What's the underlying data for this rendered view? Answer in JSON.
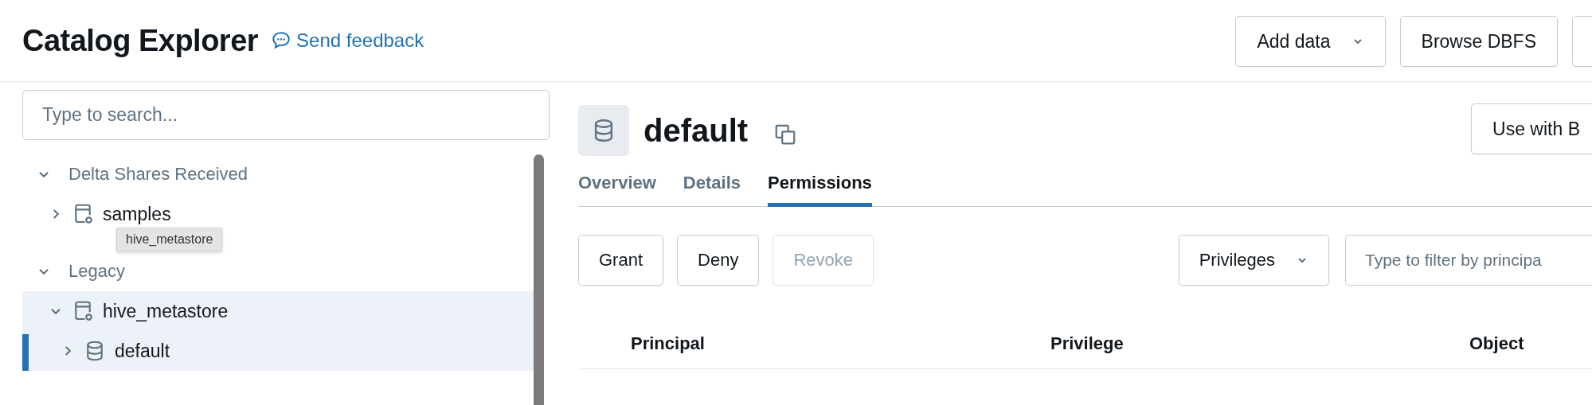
{
  "header": {
    "title": "Catalog Explorer",
    "feedback_link": "Send feedback",
    "buttons": [
      {
        "label": "Add data",
        "kind": "dropdown"
      },
      {
        "label": "Browse DBFS",
        "kind": "plain"
      },
      {
        "kind": "cut"
      }
    ]
  },
  "sidebar": {
    "search": {
      "placeholder": "Type to search..."
    },
    "tree": [
      {
        "label": "Delta Shares Received",
        "kind": "section",
        "expanded": true,
        "selected": false,
        "children": [
          {
            "label": "samples",
            "kind": "catalog",
            "expanded": false,
            "selected": false,
            "highlighted": false
          }
        ]
      },
      {
        "label": "Legacy",
        "kind": "section",
        "expanded": true,
        "selected": false,
        "children": [
          {
            "label": "hive_metastore",
            "kind": "catalog",
            "expanded": true,
            "selected": false,
            "highlighted": true,
            "children": [
              {
                "label": "default",
                "kind": "schema",
                "expanded": false,
                "selected": true,
                "highlighted": true
              }
            ]
          }
        ]
      }
    ],
    "tooltip": "hive_metastore"
  },
  "main": {
    "title": "default",
    "action_button": "Use with B",
    "tabs": [
      {
        "label": "Overview",
        "selected": false
      },
      {
        "label": "Details",
        "selected": false
      },
      {
        "label": "Permissions",
        "selected": true
      }
    ],
    "toolbar": {
      "buttons": [
        {
          "label": "Grant",
          "disabled": false
        },
        {
          "label": "Deny",
          "disabled": false
        },
        {
          "label": "Revoke",
          "disabled": true
        }
      ],
      "filter_dropdown": "Privileges",
      "filter": {
        "placeholder": "Type to filter by principa"
      }
    },
    "table": {
      "columns": [
        "Principal",
        "Privilege",
        "Object"
      ]
    }
  }
}
